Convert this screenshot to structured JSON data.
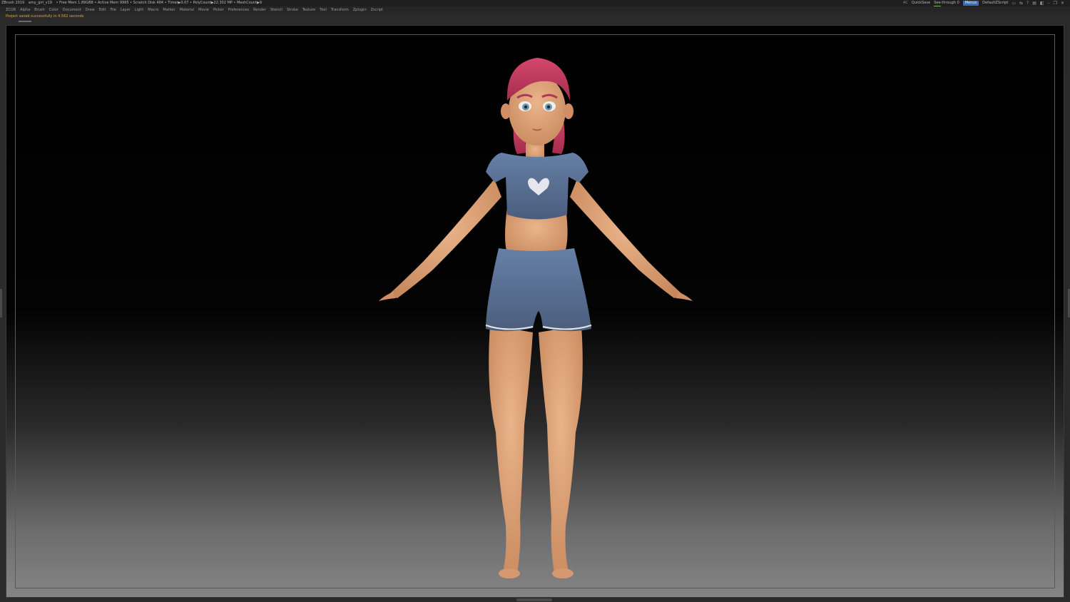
{
  "titlebar": {
    "app": "ZBrush 2019",
    "file": "amy_girl_v19",
    "stats": "• Free Mem 1.89GB8 • Active Mem 9965 • Scratch Disk 484 • Timer▶0.07 • PolyCount▶22.302 MP • MeshCount▶9",
    "ac": "AC",
    "quicksave": "QuickSave",
    "seethrough": "See-through 0",
    "menus_button": "Menus",
    "default_script": "DefaultZScript"
  },
  "menubar": {
    "items": [
      "ZCUR",
      "Alpha",
      "Brush",
      "Color",
      "Document",
      "Draw",
      "Edit",
      "File",
      "Layer",
      "Light",
      "Macro",
      "Marker",
      "Material",
      "Movie",
      "Picker",
      "Preferences",
      "Render",
      "Stencil",
      "Stroke",
      "Texture",
      "Tool",
      "Transform",
      "Zplugin",
      "Zscript"
    ]
  },
  "notice": {
    "text": "Project saved successfully in 4.562 seconds"
  },
  "colors": {
    "skin": "#e3a57b",
    "hair": "#c23a5e",
    "clothes": "#5a6f92",
    "accent": "#3a6fb6",
    "notice": "#e2a23a"
  }
}
